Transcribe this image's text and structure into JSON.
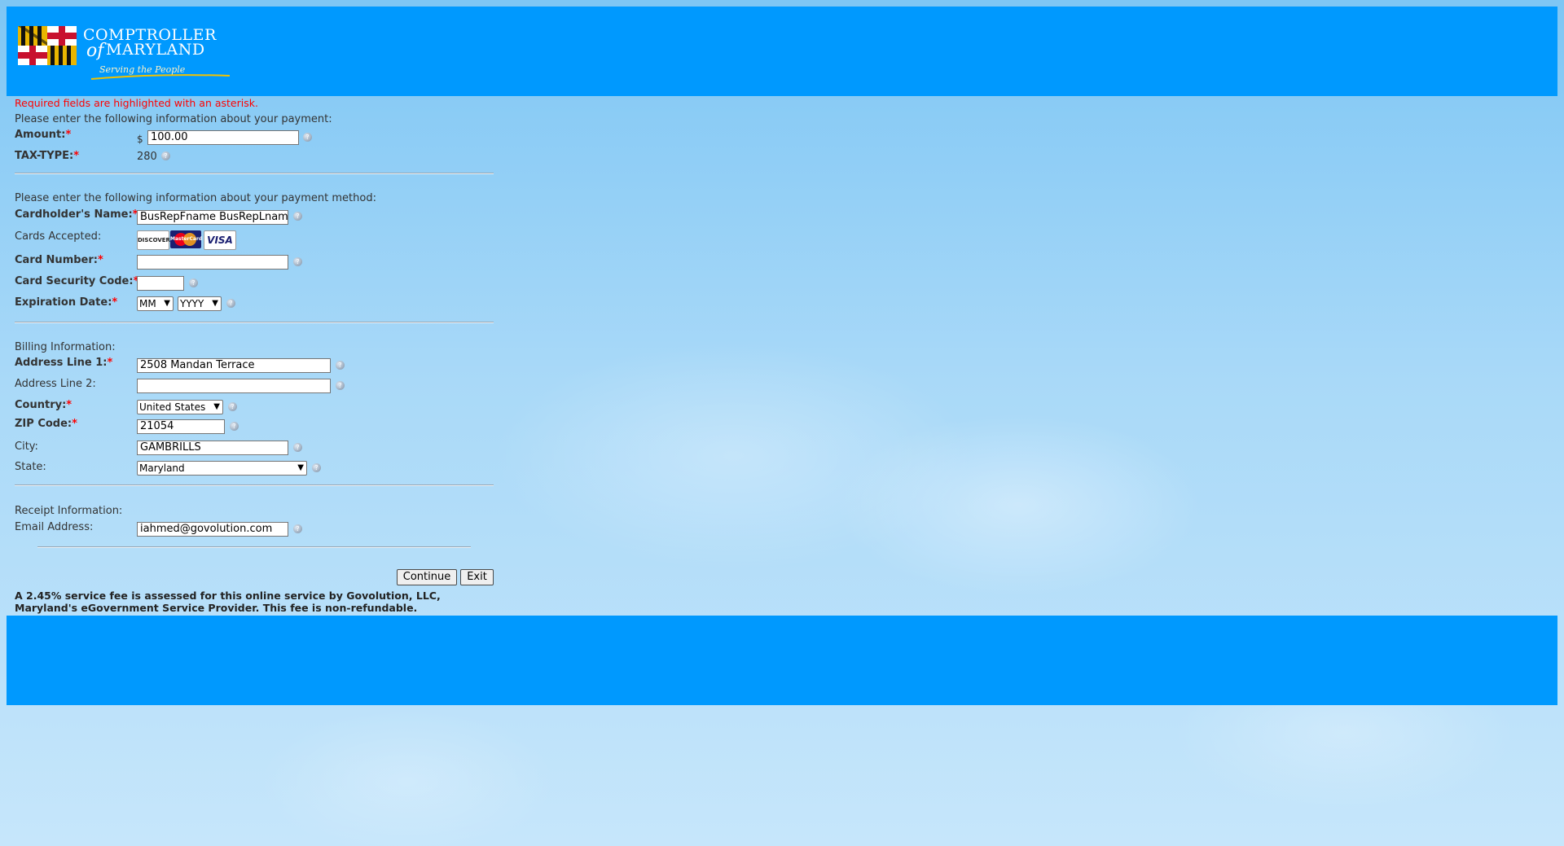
{
  "header": {
    "logo": {
      "line1": "COMPTROLLER",
      "of": "of",
      "line2": "MARYLAND",
      "tagline": "Serving the People"
    }
  },
  "form": {
    "required_note": "Required fields are highlighted with an asterisk.",
    "payment_intro": "Please enter the following information about your payment:",
    "amount": {
      "label": "Amount:",
      "currency": "$",
      "value": "100.00"
    },
    "tax_type": {
      "label": "TAX-TYPE:",
      "value": "280"
    },
    "method_intro": "Please enter the following information about your payment method:",
    "cardholder": {
      "label": "Cardholder's Name:",
      "value": "BusRepFname BusRepLnam"
    },
    "cards_accepted": {
      "label": "Cards Accepted:",
      "cards": [
        "DISCOVER",
        "MasterCard",
        "VISA"
      ]
    },
    "card_number": {
      "label": "Card Number:",
      "value": ""
    },
    "security_code": {
      "label": "Card Security Code:",
      "value": ""
    },
    "expiration": {
      "label": "Expiration Date:",
      "month": "MM",
      "year": "YYYY"
    },
    "billing_intro": "Billing Information:",
    "address1": {
      "label": "Address Line 1:",
      "value": "2508 Mandan Terrace"
    },
    "address2": {
      "label": "Address Line 2:",
      "value": ""
    },
    "country": {
      "label": "Country:",
      "value": "United States"
    },
    "zip": {
      "label": "ZIP Code:",
      "value": "21054"
    },
    "city": {
      "label": "City:",
      "value": "GAMBRILLS"
    },
    "state": {
      "label": "State:",
      "value": "Maryland"
    },
    "receipt_intro": "Receipt Information:",
    "email": {
      "label": "Email Address:",
      "value": "iahmed@govolution.com"
    },
    "buttons": {
      "continue": "Continue",
      "exit": "Exit"
    },
    "fee_note": "A 2.45% service fee is assessed for this online service by Govolution, LLC, Maryland's eGovernment Service Provider. This fee is non-refundable."
  },
  "colors": {
    "band": "#0099fe",
    "required": "#ff0000"
  }
}
